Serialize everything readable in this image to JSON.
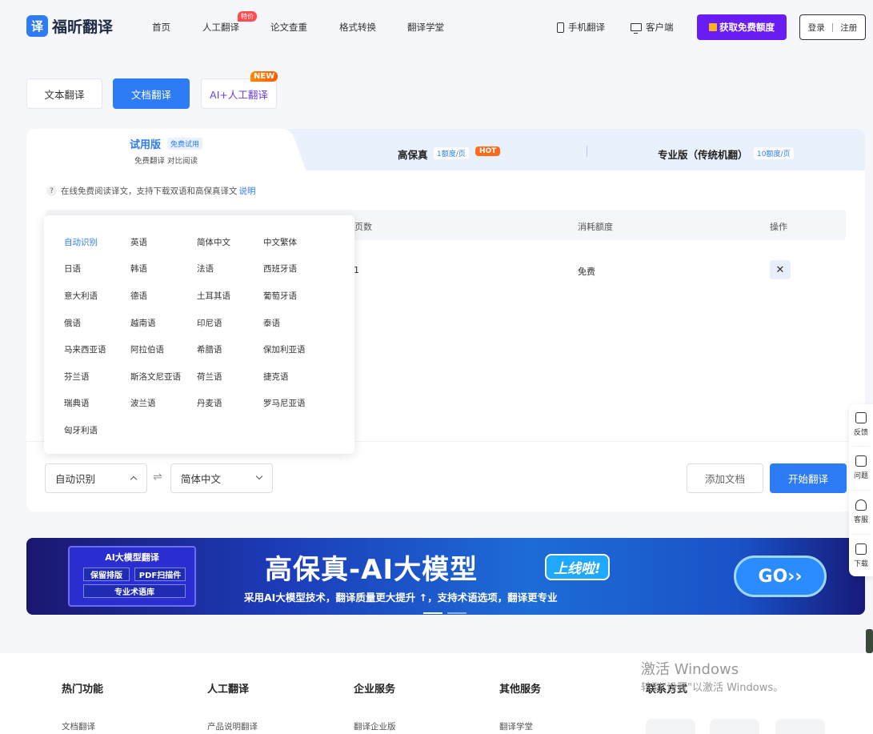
{
  "brand": {
    "logo_glyph": "译",
    "name": "福昕翻译"
  },
  "nav": {
    "home": "首页",
    "human": "人工翻译",
    "human_badge": "特价",
    "paper": "论文查重",
    "convert": "格式转换",
    "academy": "翻译学堂",
    "mobile": "手机翻译",
    "client": "客户端",
    "free_quota": "获取免费额度",
    "login": "登录",
    "register": "注册"
  },
  "mode_tabs": {
    "text": "文本翻译",
    "doc": "文档翻译",
    "ai_human": "AI+人工翻译",
    "new_badge": "NEW"
  },
  "version_tabs": {
    "trial": {
      "title": "试用版",
      "pill": "免费试用",
      "sub": "免费翻译 对比阅读"
    },
    "hifi": {
      "title": "高保真",
      "pill": "1额度/页",
      "hot": "HOT"
    },
    "pro": {
      "title": "专业版（传统机翻）",
      "pill": "10额度/页"
    }
  },
  "info": {
    "text": "在线免费阅读译文，支持下载双语和高保真译文",
    "link": "说明",
    "icon": "question-icon"
  },
  "table": {
    "headers": {
      "pages": "页数",
      "quota": "消耗额度",
      "action": "操作"
    },
    "row": {
      "pages": "1",
      "quota": "免费"
    }
  },
  "languages": [
    [
      "自动识别",
      "英语",
      "简体中文",
      "中文繁体"
    ],
    [
      "日语",
      "韩语",
      "法语",
      "西班牙语"
    ],
    [
      "意大利语",
      "德语",
      "土耳其语",
      "葡萄牙语"
    ],
    [
      "俄语",
      "越南语",
      "印尼语",
      "泰语"
    ],
    [
      "马来西亚语",
      "阿拉伯语",
      "希腊语",
      "保加利亚语"
    ],
    [
      "芬兰语",
      "斯洛文尼亚语",
      "荷兰语",
      "捷克语"
    ],
    [
      "瑞典语",
      "波兰语",
      "丹麦语",
      "罗马尼亚语"
    ],
    [
      "匈牙利语"
    ]
  ],
  "controls": {
    "source_lang": "自动识别",
    "target_lang": "简体中文",
    "swap_glyph": "⇌",
    "add_doc": "添加文档",
    "start": "开始翻译"
  },
  "banner": {
    "box_title": "AI大模型翻译",
    "chip1": "保留排版",
    "chip2": "PDF扫描件",
    "chip3": "专业术语库",
    "title": "高保真-AI大模型",
    "tag": "上线啦!",
    "subtitle": "采用AI大模型技术，翻译质量更大提升 ↑，支持术语选项，翻译更专业",
    "go": "GO››"
  },
  "footer": {
    "cols": [
      "热门功能",
      "人工翻译",
      "企业服务",
      "其他服务",
      "联系方式"
    ],
    "links": [
      "文档翻译",
      "产品说明翻译",
      "翻译企业版",
      "翻译学堂"
    ]
  },
  "watermark": {
    "line1": "激活 Windows",
    "line2": "转到\"设置\"以激活 Windows。"
  },
  "sidebar": {
    "feedback": "反馈",
    "question": "问题",
    "service": "客服",
    "download": "下载"
  },
  "colors": {
    "primary": "#2d7cf5",
    "purple": "#6a1cf5",
    "hot": "#ff6a1a"
  }
}
